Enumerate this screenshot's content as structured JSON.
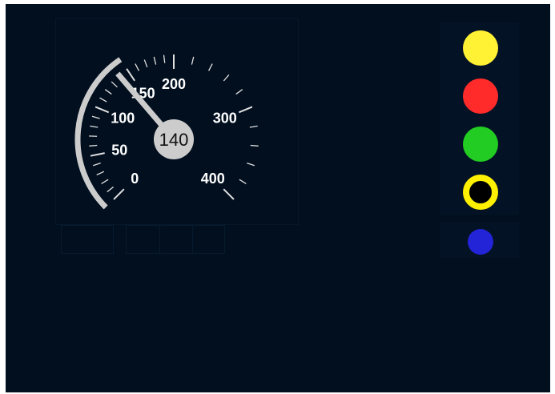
{
  "speedometer": {
    "current_speed": 140,
    "current_speed_label": "140",
    "max_speed": 400,
    "tick_labels": [
      "0",
      "50",
      "100",
      "150",
      "200",
      "300",
      "400"
    ],
    "permitted_speed": 150,
    "colors": {
      "needle": "#cccccc",
      "ticks": "#e0e0e0",
      "labels": "#ffffff",
      "arc": "#cccccc",
      "hub": "#cccccc",
      "hub_text": "#111111"
    }
  },
  "indicators": [
    {
      "name": "yellow-lamp",
      "color": "#fff133",
      "style": "filled"
    },
    {
      "name": "red-lamp",
      "color": "#ff2b2b",
      "style": "filled"
    },
    {
      "name": "green-lamp",
      "color": "#22cc22",
      "style": "filled"
    },
    {
      "name": "yellow-ring-lamp",
      "color": "#fff000",
      "style": "ring"
    },
    {
      "name": "blue-lamp",
      "color": "#2323d8",
      "style": "filled"
    }
  ]
}
